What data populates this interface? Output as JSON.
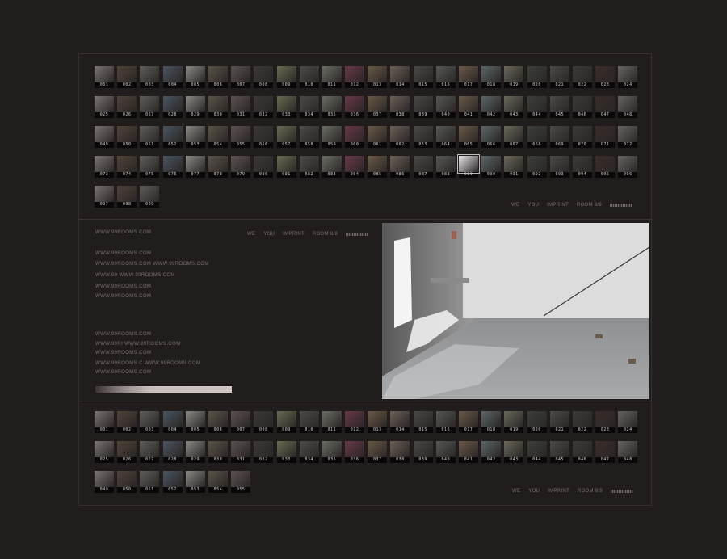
{
  "nav": {
    "items": [
      "WE",
      "YOU",
      "IMPRINT",
      "ROOM 8/9"
    ]
  },
  "top_grid": {
    "labels": [
      "001",
      "002",
      "003",
      "004",
      "005",
      "006",
      "007",
      "008",
      "009",
      "010",
      "011",
      "012",
      "013",
      "014",
      "015",
      "016",
      "017",
      "018",
      "019",
      "020",
      "021",
      "022",
      "023",
      "024",
      "025",
      "026",
      "027",
      "028",
      "029",
      "030",
      "031",
      "032",
      "033",
      "034",
      "035",
      "036",
      "037",
      "038",
      "039",
      "040",
      "041",
      "042",
      "043",
      "044",
      "045",
      "046",
      "047",
      "048",
      "049",
      "050",
      "051",
      "052",
      "053",
      "054",
      "055",
      "056",
      "057",
      "058",
      "059",
      "060",
      "061",
      "062",
      "063",
      "064",
      "065",
      "066",
      "067",
      "068",
      "069",
      "070",
      "071",
      "072",
      "073",
      "074",
      "075",
      "076",
      "077",
      "078",
      "079",
      "080",
      "081",
      "082",
      "083",
      "084",
      "085",
      "086",
      "087",
      "088",
      "089",
      "090",
      "091",
      "092",
      "093",
      "094",
      "095",
      "096",
      "097",
      "098",
      "099"
    ],
    "selected_label": "089"
  },
  "bottom_grid": {
    "labels": [
      "001",
      "002",
      "003",
      "004",
      "005",
      "006",
      "007",
      "008",
      "009",
      "010",
      "011",
      "012",
      "013",
      "014",
      "015",
      "016",
      "017",
      "018",
      "019",
      "020",
      "021",
      "022",
      "023",
      "024",
      "025",
      "026",
      "027",
      "028",
      "029",
      "030",
      "031",
      "032",
      "033",
      "034",
      "035",
      "036",
      "037",
      "038",
      "039",
      "040",
      "041",
      "042",
      "043",
      "044",
      "045",
      "046",
      "047",
      "048",
      "049",
      "050",
      "051",
      "052",
      "053",
      "054",
      "055"
    ]
  },
  "middle": {
    "header_url": "WWW.99ROOMS.COM",
    "text_lines_a": [
      "WWW.99ROOMS.COM",
      "WWW.99ROOMS.COM  WWW.99ROOMS.COM",
      "WWW.99  WWW.99ROOMS.COM",
      "WWW.99ROOMS.COM",
      "WWW.99ROOMS.COM"
    ],
    "text_lines_b": [
      "WWW.99ROOMS.COM",
      "WWW.99RI  WWW.99ROOMS.COM",
      "WWW.99ROOMS.COM",
      "WWW.99ROOMS.C  WWW.99ROOMS.COM",
      "WWW.99ROOMS.COM"
    ],
    "progress": 1.0
  },
  "thumb_colors": [
    "#4a5560",
    "#6a6d64",
    "#5c6668",
    "#7a7571",
    "#3c3834",
    "#4b4744",
    "#3d3a38",
    "#8a8a85",
    "#6a3848",
    "#6a6858",
    "#4f4336",
    "#6a6a50",
    "#565852",
    "#3a2c2a",
    "#5a5446",
    "#6a5a46",
    "#3c403a",
    "#5e5e5c",
    "#4e4a48",
    "#6a5a48",
    "#666462",
    "#5a5250",
    "#6a6056",
    "#4a4a46"
  ]
}
